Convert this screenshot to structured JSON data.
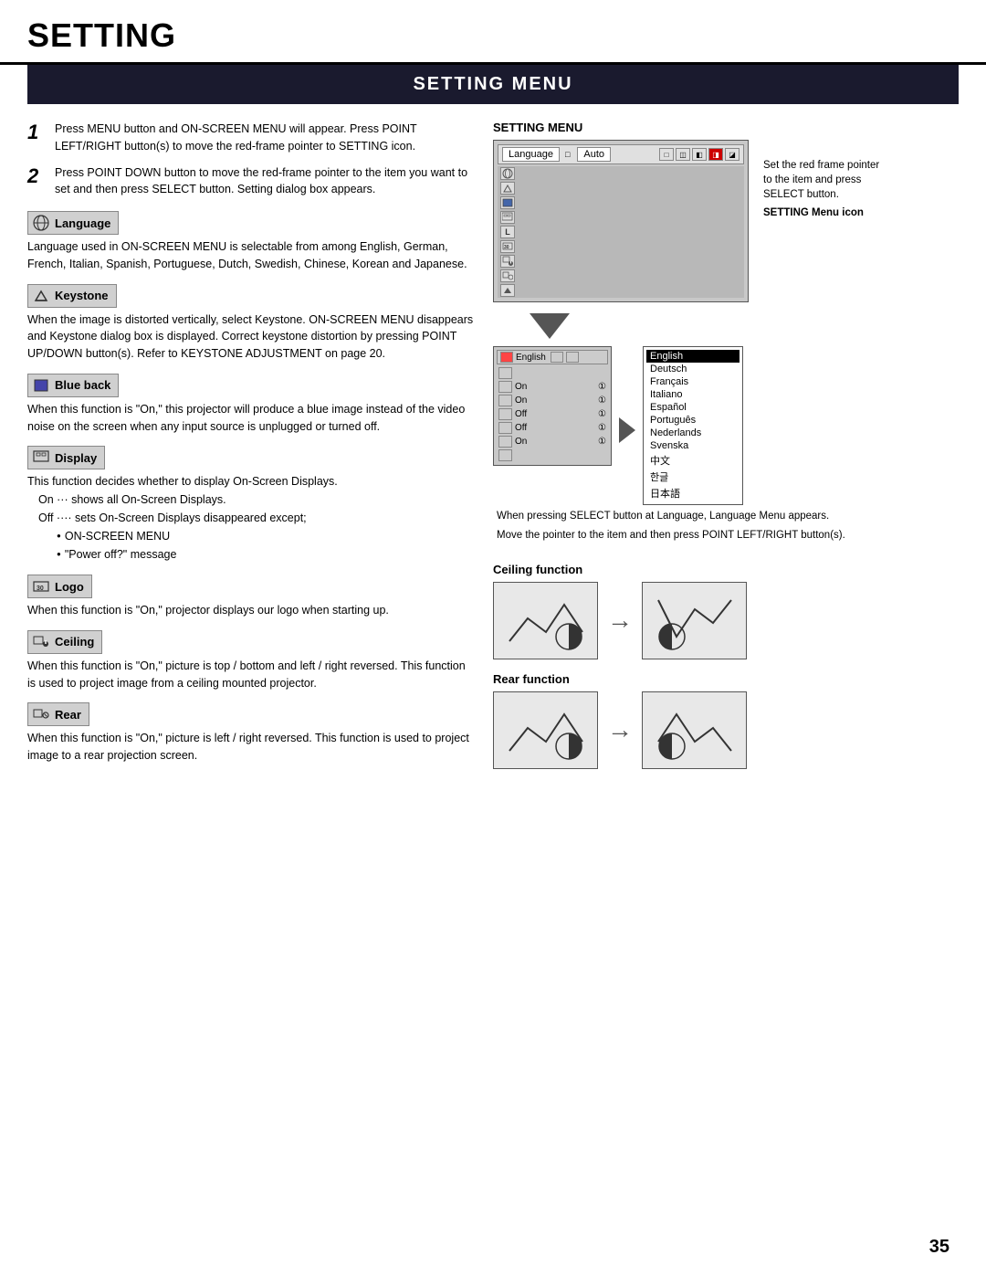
{
  "page": {
    "title": "SETTING",
    "page_number": "35"
  },
  "section": {
    "title": "SETTING MENU"
  },
  "steps": [
    {
      "num": "1",
      "text": "Press MENU button and ON-SCREEN MENU will appear.  Press POINT LEFT/RIGHT button(s) to move the red-frame pointer to SETTING icon."
    },
    {
      "num": "2",
      "text": "Press POINT DOWN button to move the red-frame pointer to the item you want to set and then press SELECT button.  Setting dialog box appears."
    }
  ],
  "features": [
    {
      "id": "language",
      "label": "Language",
      "icon": "🌐",
      "text": "Language used in ON-SCREEN MENU is selectable from among English, German, French, Italian, Spanish, Portuguese, Dutch, Swedish, Chinese, Korean and Japanese."
    },
    {
      "id": "keystone",
      "label": "Keystone",
      "icon": "▽",
      "text": "When the image is distorted vertically, select Keystone.  ON-SCREEN MENU disappears and Keystone dialog box is displayed. Correct keystone distortion by pressing POINT UP/DOWN button(s). Refer to KEYSTONE ADJUSTMENT on page 20."
    },
    {
      "id": "blue-back",
      "label": "Blue back",
      "icon": "□",
      "text": "When this function is \"On,\" this projector will produce a blue image instead of the video noise on the screen when any input source is unplugged or turned off."
    },
    {
      "id": "display",
      "label": "Display",
      "icon": "⊞",
      "text": "This function decides whether to display On-Screen Displays.",
      "sub": [
        "On ···  shows all On-Screen Displays.",
        "Off ···· sets On-Screen Displays disappeared except;"
      ],
      "bullets": [
        "ON-SCREEN MENU",
        "\"Power off?\" message"
      ]
    },
    {
      "id": "logo",
      "label": "Logo",
      "icon": "30",
      "text": "When this function is \"On,\" projector displays our logo when starting up."
    },
    {
      "id": "ceiling",
      "label": "Ceiling",
      "icon": "⌐",
      "text": "When this function is \"On,\" picture is top / bottom and left / right reversed.  This function is used to project image from a ceiling mounted projector."
    },
    {
      "id": "rear",
      "label": "Rear",
      "icon": "◑",
      "text": "When this function is \"On,\" picture is left / right reversed.  This function is used to project image to a rear projection screen."
    }
  ],
  "right_panel": {
    "setting_menu_label": "SETTING MENU",
    "callout1": "Set the red frame pointer to the item and press SELECT button.",
    "callout2": "SETTING Menu icon",
    "when_pressing": "When pressing SELECT button at Language, Language Menu appears.",
    "move_pointer": "Move the pointer to the item and then press POINT LEFT/RIGHT button(s).",
    "languages": [
      "English",
      "Deutsch",
      "Français",
      "Italiano",
      "Español",
      "Português",
      "Nederlands",
      "Svenska",
      "中文",
      "한글",
      "日本語"
    ],
    "ceiling_label": "Ceiling function",
    "rear_label": "Rear function"
  },
  "menu_mock": {
    "lang_tab": "Language",
    "auto_tab": "Auto",
    "rows": [
      {
        "icon": "globe",
        "label": ""
      },
      {
        "icon": "keystone",
        "label": ""
      },
      {
        "icon": "blueback",
        "label": ""
      },
      {
        "icon": "display",
        "label": ""
      },
      {
        "icon": "L",
        "label": ""
      },
      {
        "icon": "logo",
        "label": ""
      },
      {
        "icon": "ceiling",
        "label": ""
      },
      {
        "icon": "rear",
        "label": ""
      },
      {
        "icon": "arrow",
        "label": ""
      }
    ]
  },
  "lang_menu": {
    "rows": [
      {
        "label": "English",
        "value": ""
      },
      {
        "label": "On",
        "value": "①"
      },
      {
        "label": "On",
        "value": "①"
      },
      {
        "label": "Off",
        "value": "①"
      },
      {
        "label": "Off",
        "value": "①"
      },
      {
        "label": "On",
        "value": "①"
      }
    ]
  }
}
